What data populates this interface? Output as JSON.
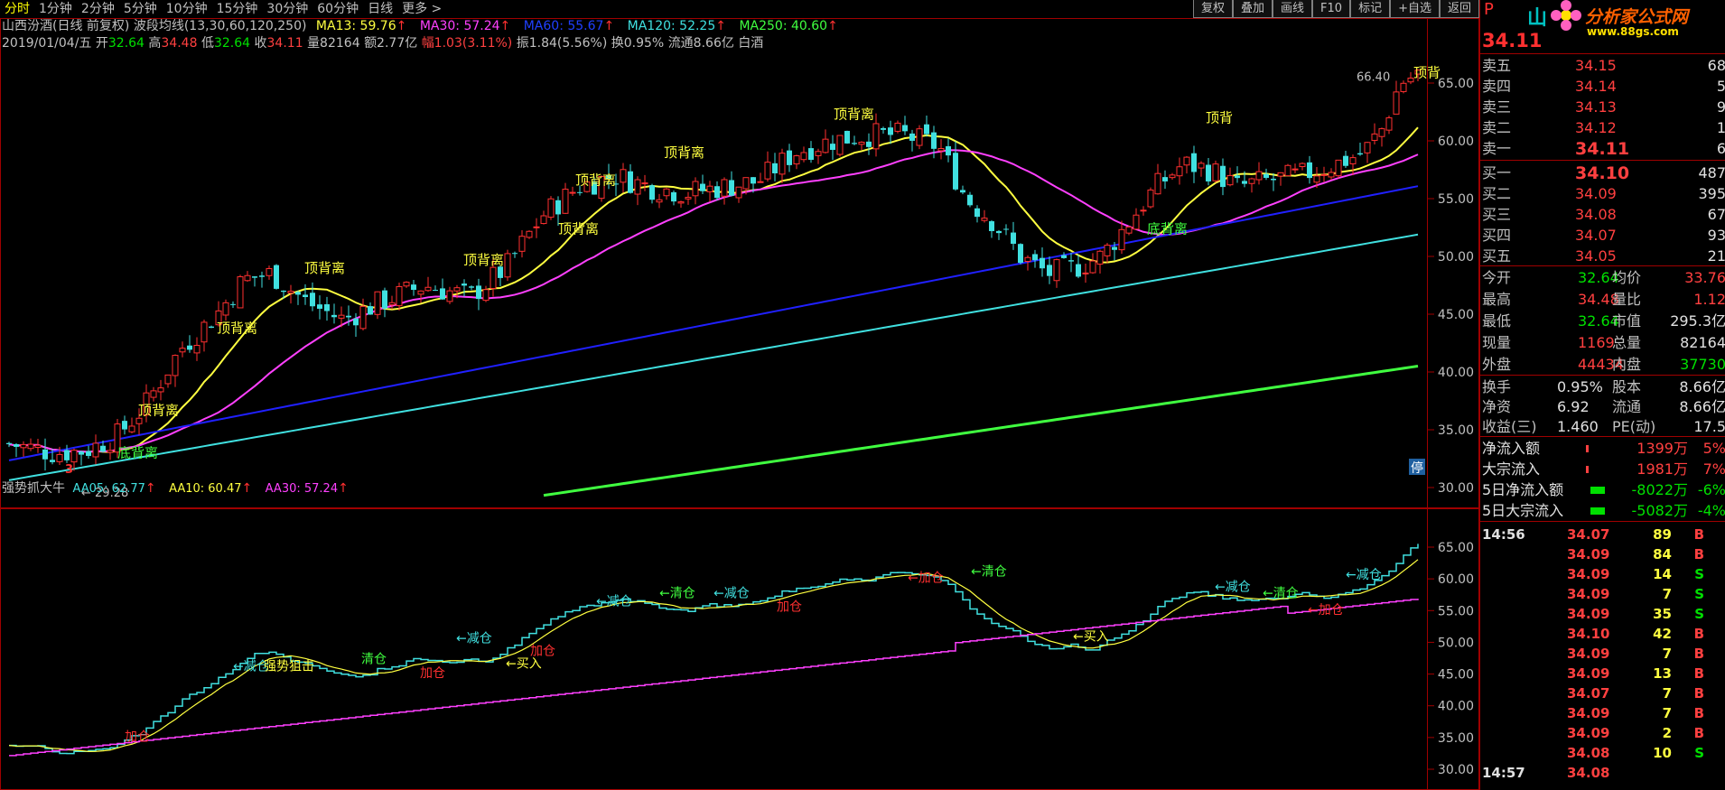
{
  "tabs": [
    "分时",
    "1分钟",
    "2分钟",
    "5分钟",
    "10分钟",
    "15分钟",
    "30分钟",
    "60分钟",
    "日线",
    "更多 >"
  ],
  "active_tab": 0,
  "toolbar": [
    "复权",
    "叠加",
    "画线",
    "F10",
    "标记",
    "+自选",
    "返回"
  ],
  "header1": {
    "stock": "山西汾酒(日线 前复权)",
    "indicator": "波段均线(13,30,60,120,250)",
    "ma13": "MA13: 59.76",
    "ma30": "MA30: 57.24",
    "ma60": "MA60: 55.67",
    "ma120": "MA120: 52.25",
    "ma250": "MA250: 40.60"
  },
  "header2": {
    "date": "2019/01/04/五",
    "open_l": "开",
    "open_v": "32.64",
    "high_l": "高",
    "high_v": "34.48",
    "low_l": "低",
    "low_v": "32.64",
    "close_l": "收",
    "close_v": "34.11",
    "vol": "量82164",
    "amt": "额2.77亿",
    "chg": "幅1.03(3.11%)",
    "amp": "振1.84(5.56%)",
    "turn": "换0.95%",
    "circ": "流通8.66亿",
    "sector": "白酒"
  },
  "price_axis": [
    "65.00",
    "60.00",
    "55.00",
    "50.00",
    "45.00",
    "40.00",
    "35.00",
    "30.00"
  ],
  "price_annotations": {
    "high": "66.40",
    "low": "← 29.28",
    "marker": "3",
    "stop": "停"
  },
  "signals_top": [
    {
      "text": "顶背离",
      "color": "#ffff40"
    },
    {
      "text": "顶背离",
      "color": "#ffff40"
    },
    {
      "text": "顶背离",
      "color": "#ffff40"
    },
    {
      "text": "顶背离",
      "color": "#ffff40"
    },
    {
      "text": "顶背离",
      "color": "#ffff40"
    },
    {
      "text": "顶背离",
      "color": "#ffff40"
    },
    {
      "text": "顶背离",
      "color": "#ffff40"
    },
    {
      "text": "顶背离",
      "color": "#ffff40"
    },
    {
      "text": "顶背",
      "color": "#ffff40"
    },
    {
      "text": "底背离",
      "color": "#40ff40"
    },
    {
      "text": "底背离",
      "color": "#40ff40"
    }
  ],
  "sub_header": {
    "name": "强势抓大牛",
    "aa05": "AA05: 62.77",
    "aa10": "AA10: 60.47",
    "aa30": "AA30: 57.24"
  },
  "sub_axis": [
    "65.00",
    "60.00",
    "55.00",
    "50.00",
    "45.00",
    "40.00",
    "35.00",
    "30.00"
  ],
  "sub_signals": [
    {
      "text": "加仓",
      "color": "#ff3030"
    },
    {
      "text": "←减仓",
      "color": "#40e0e0"
    },
    {
      "text": "强势狙击",
      "color": "#ffff40"
    },
    {
      "text": "清仓",
      "color": "#40ff40"
    },
    {
      "text": "加仓",
      "color": "#ff3030"
    },
    {
      "text": "←减仓",
      "color": "#40e0e0"
    },
    {
      "text": "加仓",
      "color": "#ff3030"
    },
    {
      "text": "←买入",
      "color": "#ffff40"
    },
    {
      "text": "←减仓",
      "color": "#40e0e0"
    },
    {
      "text": "←清仓",
      "color": "#40ff40"
    },
    {
      "text": "←减仓",
      "color": "#40e0e0"
    },
    {
      "text": "加仓",
      "color": "#ff3030"
    },
    {
      "text": "←加仓",
      "color": "#ff3030"
    },
    {
      "text": "←清仓",
      "color": "#40ff40"
    },
    {
      "text": "←买入",
      "color": "#ffff40"
    },
    {
      "text": "←减仓",
      "color": "#40e0e0"
    },
    {
      "text": "←清仓",
      "color": "#40ff40"
    },
    {
      "text": "←加仓",
      "color": "#ff3030"
    },
    {
      "text": "←减仓",
      "color": "#40e0e0"
    }
  ],
  "right_panel": {
    "p_label": "P",
    "logo": "分析家公式网",
    "logo_url": "www.88gs.com",
    "logo_prefix": "山",
    "price": "34.11",
    "asks": [
      {
        "label": "卖五",
        "price": "34.15",
        "vol": "68"
      },
      {
        "label": "卖四",
        "price": "34.14",
        "vol": "5"
      },
      {
        "label": "卖三",
        "price": "34.13",
        "vol": "9"
      },
      {
        "label": "卖二",
        "price": "34.12",
        "vol": "1"
      },
      {
        "label": "卖一",
        "price": "34.11",
        "vol": "6"
      }
    ],
    "bids": [
      {
        "label": "买一",
        "price": "34.10",
        "vol": "487"
      },
      {
        "label": "买二",
        "price": "34.09",
        "vol": "395"
      },
      {
        "label": "买三",
        "price": "34.08",
        "vol": "67"
      },
      {
        "label": "买四",
        "price": "34.07",
        "vol": "93"
      },
      {
        "label": "买五",
        "price": "34.05",
        "vol": "21"
      }
    ],
    "stats": [
      {
        "l1": "今开",
        "v1": "32.64",
        "c1": "#00e000",
        "l2": "均价",
        "v2": "33.76",
        "c2": "#ff4040"
      },
      {
        "l1": "最高",
        "v1": "34.48",
        "c1": "#ff4040",
        "l2": "量比",
        "v2": "1.12",
        "c2": "#ff4040"
      },
      {
        "l1": "最低",
        "v1": "32.64",
        "c1": "#00e000",
        "l2": "市值",
        "v2": "295.3亿",
        "c2": "#e0e0e0"
      },
      {
        "l1": "现量",
        "v1": "1169",
        "c1": "#ff4040",
        "l2": "总量",
        "v2": "82164",
        "c2": "#e0e0e0"
      },
      {
        "l1": "外盘",
        "v1": "44434",
        "c1": "#ff4040",
        "l2": "内盘",
        "v2": "37730",
        "c2": "#00e000"
      }
    ],
    "stats2": [
      {
        "l1": "换手",
        "v1": "0.95%",
        "l2": "股本",
        "v2": "8.66亿"
      },
      {
        "l1": "净资",
        "v1": "6.92",
        "l2": "流通",
        "v2": "8.66亿"
      },
      {
        "l1": "收益(三)",
        "v1": "1.460",
        "l2": "PE(动)",
        "v2": "17.5"
      }
    ],
    "flows": [
      {
        "label": "净流入额",
        "value": "1399万",
        "pct": "5%",
        "color": "#ff4040",
        "bar_color": "#ff4040"
      },
      {
        "label": "大宗流入",
        "value": "1981万",
        "pct": "7%",
        "color": "#ff4040",
        "bar_color": "#ff4040"
      },
      {
        "label": "5日净流入额",
        "value": "-8022万",
        "pct": "-6%",
        "color": "#00e000",
        "bar_color": "#00e000"
      },
      {
        "label": "5日大宗流入",
        "value": "-5082万",
        "pct": "-4%",
        "color": "#00e000",
        "bar_color": "#00e000"
      }
    ],
    "ticks": [
      {
        "time": "14:56",
        "price": "34.07",
        "vol": "89",
        "side": "B"
      },
      {
        "time": "",
        "price": "34.09",
        "vol": "84",
        "side": "B"
      },
      {
        "time": "",
        "price": "34.09",
        "vol": "14",
        "side": "S"
      },
      {
        "time": "",
        "price": "34.09",
        "vol": "7",
        "side": "S"
      },
      {
        "time": "",
        "price": "34.09",
        "vol": "35",
        "side": "S"
      },
      {
        "time": "",
        "price": "34.10",
        "vol": "42",
        "side": "B"
      },
      {
        "time": "",
        "price": "34.09",
        "vol": "7",
        "side": "B"
      },
      {
        "time": "",
        "price": "34.09",
        "vol": "13",
        "side": "B"
      },
      {
        "time": "",
        "price": "34.07",
        "vol": "7",
        "side": "B"
      },
      {
        "time": "",
        "price": "34.09",
        "vol": "7",
        "side": "B"
      },
      {
        "time": "",
        "price": "34.09",
        "vol": "2",
        "side": "B"
      },
      {
        "time": "",
        "price": "34.08",
        "vol": "10",
        "side": "S"
      },
      {
        "time": "14:57",
        "price": "34.08",
        "vol": "",
        "side": ""
      }
    ]
  },
  "colors": {
    "up": "#ff3030",
    "down": "#40e0e0",
    "ma13": "#ffff40",
    "ma30": "#ff40ff",
    "ma60": "#2020ff",
    "ma120": "#40e0e0",
    "ma250": "#40ff40",
    "border": "#a00000"
  }
}
